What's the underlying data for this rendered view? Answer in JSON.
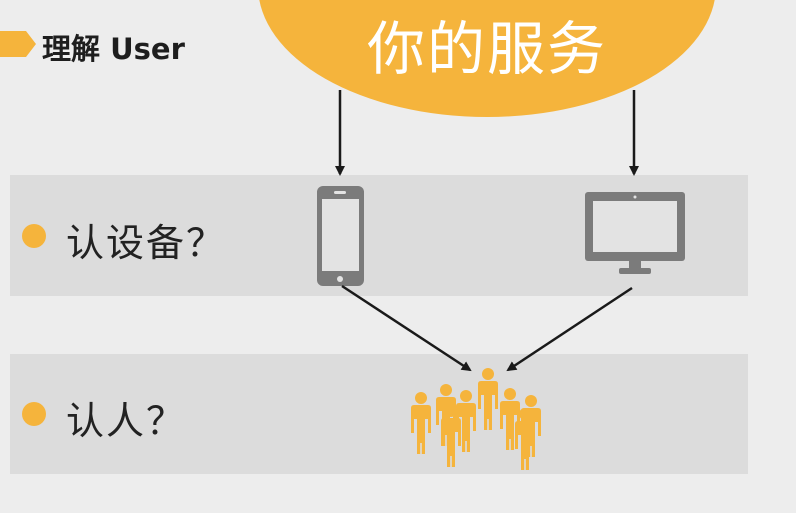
{
  "header": {
    "title": "理解 User"
  },
  "cloud": {
    "text": "你的服务"
  },
  "rows": [
    {
      "label": "认设备？",
      "icons": [
        "phone-icon",
        "monitor-icon"
      ]
    },
    {
      "label": "认人？",
      "icons": [
        "people-group-icon"
      ]
    }
  ],
  "colors": {
    "accent": "#f5b43c",
    "background": "#ededed",
    "band": "#dcdcdc",
    "device_gray": "#7b7b7b",
    "arrow": "#1a1a1a"
  }
}
